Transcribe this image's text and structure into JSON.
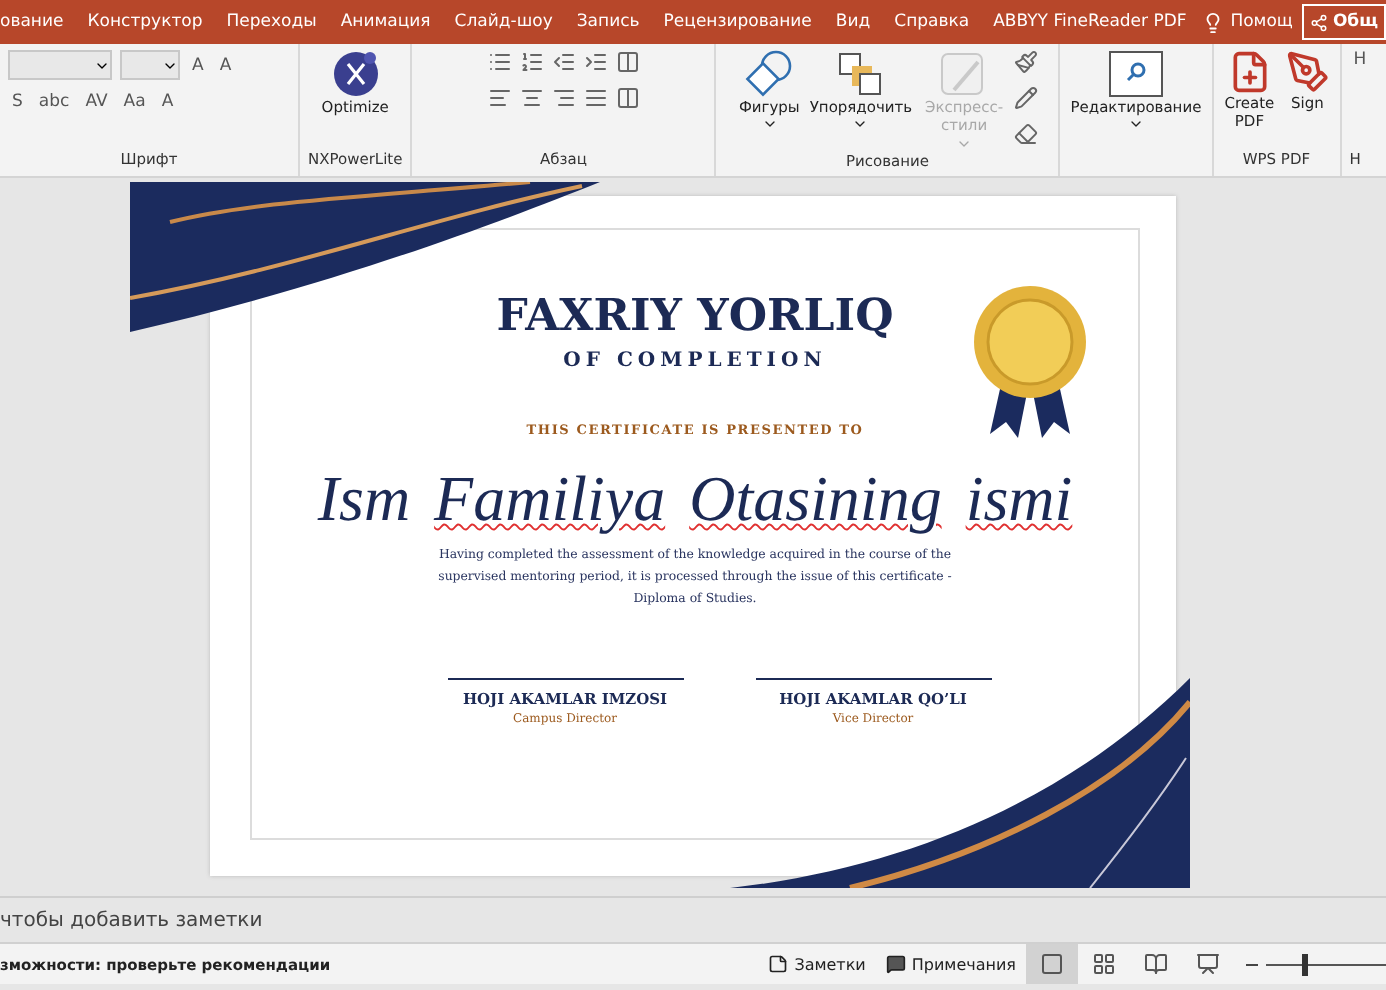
{
  "ribbon_tabs": [
    {
      "label": "ование"
    },
    {
      "label": "Конструктор"
    },
    {
      "label": "Переходы"
    },
    {
      "label": "Анимация"
    },
    {
      "label": "Слайд-шоу"
    },
    {
      "label": "Запись"
    },
    {
      "label": "Рецензирование"
    },
    {
      "label": "Вид"
    },
    {
      "label": "Справка"
    },
    {
      "label": "ABBYY FineReader PDF"
    }
  ],
  "help": {
    "label": "Помощ"
  },
  "share_button": {
    "label": "Общ"
  },
  "font_group": {
    "label": "Шрифт",
    "text_buttons": [
      "A",
      "A",
      "S",
      "abc",
      "AV",
      "Aa",
      "A"
    ]
  },
  "ribbon_groups": [
    {
      "label": "NXPowerLite",
      "items": [
        {
          "label": "Optimize",
          "kind": "plain",
          "disabled": false
        }
      ]
    },
    {
      "label": "Абзац",
      "kind": "paragraph"
    },
    {
      "label": "Рисование",
      "items": [
        {
          "label": "Фигуры",
          "kind": "split",
          "disabled": false
        },
        {
          "label": "Упорядочить",
          "kind": "split",
          "disabled": false
        },
        {
          "label": "Экспресс-стили",
          "kind": "split",
          "disabled": true
        }
      ]
    },
    {
      "items": [
        {
          "label": "Редактирование",
          "kind": "split",
          "disabled": false
        }
      ]
    },
    {
      "label": "WPS PDF",
      "items": [
        {
          "label": "Create PDF",
          "kind": "plain",
          "disabled": false
        },
        {
          "label": "Sign",
          "kind": "plain",
          "disabled": false
        }
      ]
    }
  ],
  "partial_group": {
    "top": "H",
    "label": "H"
  },
  "slide": {
    "title": "FAXRIY YORLIQ",
    "subtitle": "OF COMPLETION",
    "presented": "THIS CERTIFICATE IS PRESENTED TO",
    "name_words": [
      {
        "text": "Ism",
        "misspelled": false
      },
      {
        "text": "Familiya",
        "misspelled": true
      },
      {
        "text": "Otasining",
        "misspelled": true
      },
      {
        "text": "ismi",
        "misspelled": true
      }
    ],
    "body": "Having completed the assessment of the knowledge acquired in the course of the supervised mentoring period, it is processed through the issue of this certificate - Diploma of Studies.",
    "signatures": [
      {
        "name": "HOJI AKAMLAR IMZOSI",
        "role": "Campus Director"
      },
      {
        "name": "HOJI AKAMLAR QO’LI",
        "role": "Vice Director"
      }
    ]
  },
  "notes": {
    "placeholder": "чтобы добавить заметки"
  },
  "status_bar": {
    "message": "зможности: проверьте рекомендации",
    "notes_button": "Заметки",
    "comments_button": "Примечания",
    "views": [
      {
        "selected": true
      },
      {
        "selected": false
      },
      {
        "selected": false
      },
      {
        "selected": false
      }
    ],
    "zoom": {
      "level": 0.3
    }
  }
}
